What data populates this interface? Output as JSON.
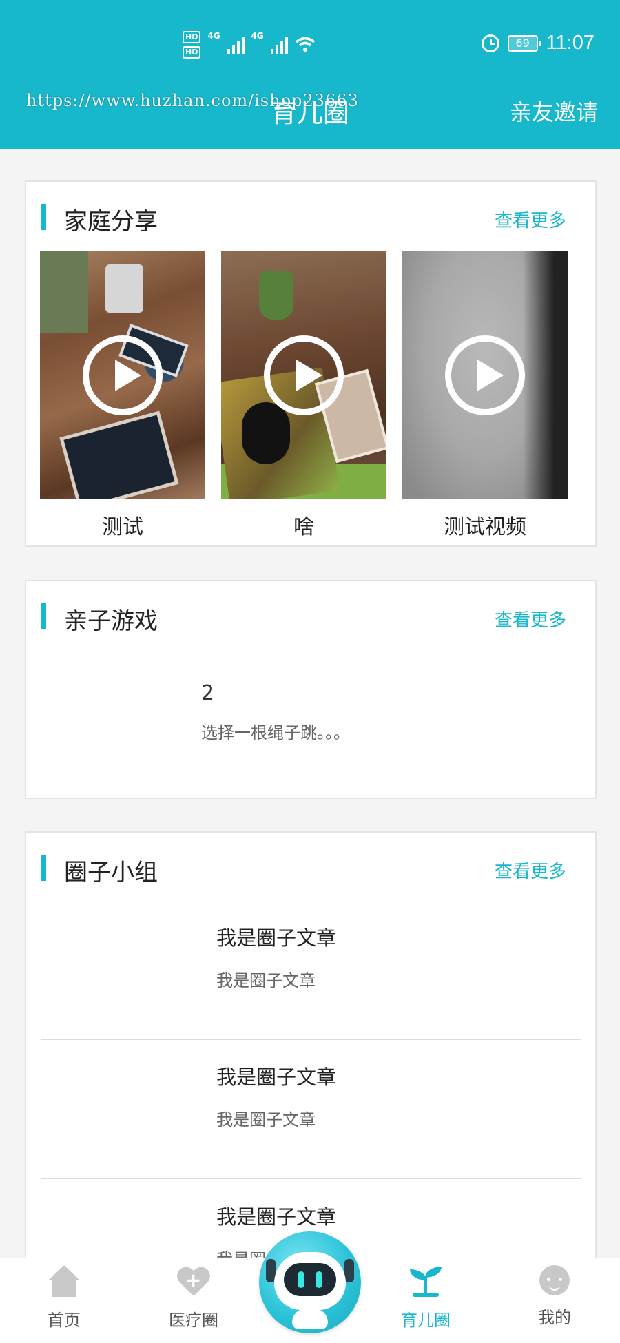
{
  "status_bar": {
    "hd1": "HD",
    "hd2": "HD",
    "net1": "4G",
    "net2": "4G",
    "battery": "69",
    "time": "11:07"
  },
  "header": {
    "watermark": "https://www.huzhan.com/ishop23663",
    "title": "育儿圈",
    "invite_label": "亲友邀请",
    "background": "#17b7cc"
  },
  "family_share": {
    "title": "家庭分享",
    "more": "查看更多",
    "videos": [
      {
        "caption": "测试"
      },
      {
        "caption": "啥"
      },
      {
        "caption": "测试视频"
      }
    ]
  },
  "parent_child_games": {
    "title": "亲子游戏",
    "more": "查看更多",
    "game": {
      "number": "2",
      "description": "选择一根绳子跳。。。"
    }
  },
  "circle_groups": {
    "title": "圈子小组",
    "more": "查看更多",
    "articles": [
      {
        "title": "我是圈子文章",
        "summary": "我是圈子文章"
      },
      {
        "title": "我是圈子文章",
        "summary": "我是圈子文章"
      },
      {
        "title": "我是圈子文章",
        "summary": "我是圈子文章"
      }
    ]
  },
  "bottom_nav": {
    "items": [
      {
        "label": "首页",
        "icon": "home-icon"
      },
      {
        "label": "医疗圈",
        "icon": "medical-heart-icon"
      },
      {
        "label": "育儿圈",
        "icon": "sprout-icon",
        "active": true
      },
      {
        "label": "我的",
        "icon": "profile-face-icon"
      }
    ],
    "center_icon": "robot-assistant-icon",
    "accent": "#17b7cc"
  }
}
